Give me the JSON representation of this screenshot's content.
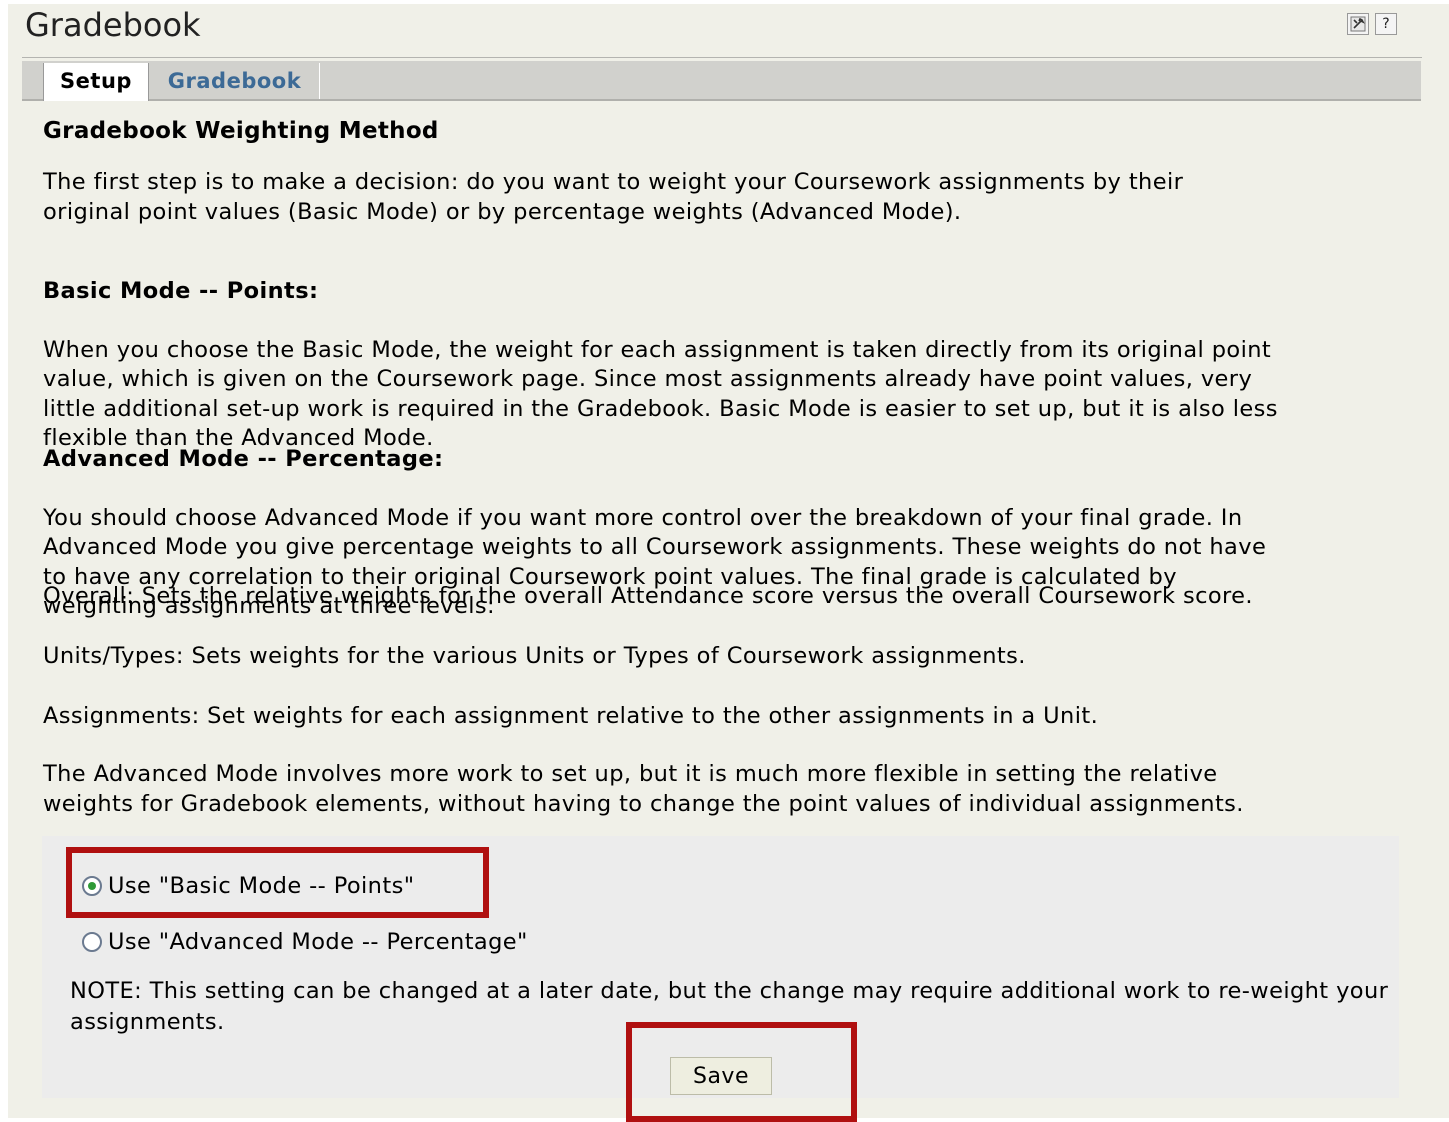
{
  "app": {
    "title": "Gradebook",
    "settings_icon": "tools-icon",
    "help_icon": "help-icon",
    "help_glyph": "?"
  },
  "tabs": [
    {
      "label": "Setup",
      "active": true
    },
    {
      "label": "Gradebook",
      "active": false
    }
  ],
  "main": {
    "heading": "Gradebook Weighting Method",
    "intro": "The first step is to make a decision: do you want to weight your Coursework assignments by their\noriginal point values (Basic Mode) or by percentage weights (Advanced Mode).",
    "basic_heading": "Basic Mode -- Points:",
    "basic_text": "When you choose the Basic Mode, the weight for each assignment is taken directly from its original point\nvalue, which is given on the Coursework page. Since most assignments already have point values, very\nlittle additional set-up work is required in the Gradebook. Basic Mode is easier to set up, but it is also less\nflexible than the Advanced Mode.",
    "advanced_heading": "Advanced Mode -- Percentage:",
    "advanced_text": "You should choose Advanced Mode if you want more control over the breakdown of your final grade. In\nAdvanced Mode you give percentage weights to all Coursework assignments. These weights do not have\nto have any correlation to their original Coursework point values. The final grade is calculated by\nweighting assignments at three levels:",
    "overall_text": "Overall: Sets the relative weights for the overall Attendance score versus the overall Coursework score.",
    "units_text": "Units/Types: Sets weights for the various Units or Types of Coursework assignments.",
    "assignments_text": "Assignments: Set weights for each assignment relative to the other assignments in a Unit.",
    "closing_text": "The Advanced Mode involves more work to set up, but it is much more flexible in setting the relative\nweights for Gradebook elements, without having to change the point values of individual assignments."
  },
  "options": {
    "basic_label": "Use \"Basic Mode -- Points\"",
    "advanced_label": "Use \"Advanced Mode -- Percentage\"",
    "selected": "basic",
    "note": "NOTE: This setting can be changed at a later date, but the change may require additional work to re-weight your assignments.",
    "save_label": "Save"
  },
  "colors": {
    "page_bg": "#f0f0e8",
    "tab_link": "#3c6a96",
    "highlight": "#b01010",
    "radio_selected": "#2e9a37"
  }
}
